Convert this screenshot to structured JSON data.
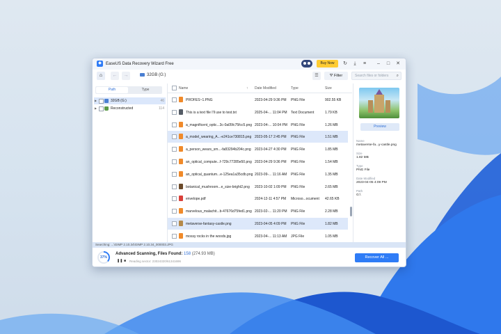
{
  "window": {
    "title": "EaseUS Data Recovery Wizard Free",
    "buy_now": "Buy Now",
    "logo_icon": "easeus-logo-icon"
  },
  "toolbar": {
    "drive_label": "32GB (G:)",
    "filter_label": "Filter",
    "search_placeholder": "Search files or folders"
  },
  "left_panel": {
    "tabs": [
      "Path",
      "Type"
    ],
    "tree": [
      {
        "label": "32GB (G:)",
        "count": "46",
        "selected": true
      },
      {
        "label": "Reconstructed",
        "count": "114",
        "selected": false
      }
    ]
  },
  "file_list": {
    "columns": [
      "Name",
      "Date Modified",
      "Type",
      "Size"
    ],
    "rows": [
      {
        "name": "PROFES~1.PNG",
        "date": "2023-04-29 9:36 PM",
        "type": "PNG File",
        "size": "902.55 KB",
        "icon_color": "#f08a2a",
        "selected": false
      },
      {
        "name": "This is a text file I'll use to test.txt",
        "date": "2025-04-... 11:04 PM",
        "type": "Text Document",
        "size": "1.79 KB",
        "icon_color": "#555c66",
        "selected": false
      },
      {
        "name": "a_magnificent_optic...3c-0a05fc75fcc5.png",
        "date": "2023-04-... 10:04 PM",
        "type": "PNG File",
        "size": "1.26 MB",
        "icon_color": "#f08a2a",
        "selected": false
      },
      {
        "name": "a_model_wearing_A...-e241ce730815.png",
        "date": "2023-05-17 2:45 PM",
        "type": "PNG File",
        "size": "1.51 MB",
        "icon_color": "#f08a2a",
        "selected": true
      },
      {
        "name": "a_person_wears_sm...-fa83294b204c.png",
        "date": "2023-04-27 4:30 PM",
        "type": "PNG File",
        "size": "1.85 MB",
        "icon_color": "#f08a2a",
        "selected": false
      },
      {
        "name": "an_optical_compute...f-729c77285e50.png",
        "date": "2023-04-29 9:36 PM",
        "type": "PNG File",
        "size": "1.54 MB",
        "icon_color": "#f08a2a",
        "selected": false
      },
      {
        "name": "an_optical_quantum...e-125ea1a35cdb.png",
        "date": "2023-09-... 11:16 AM",
        "type": "PNG File",
        "size": "1.35 MB",
        "icon_color": "#f08a2a",
        "selected": false
      },
      {
        "name": "botanical_mushroom...e_size-bright2.png",
        "date": "2023-10-02 1:09 PM",
        "type": "PNG File",
        "size": "2.65 MB",
        "icon_color": "#6b4a2a",
        "selected": false
      },
      {
        "name": "envelope.pdf",
        "date": "2024-12-11 4:57 PM",
        "type": "Microso...ocument",
        "size": "42.65 KB",
        "icon_color": "#d9403a",
        "selected": false
      },
      {
        "name": "marvelous_malachit...b-47676d75fed1.png",
        "date": "2023-02-... 11:20 PM",
        "type": "PNG File",
        "size": "2.28 MB",
        "icon_color": "#f08a2a",
        "selected": false
      },
      {
        "name": "metaverse-fantasy-castle.png",
        "date": "2023-04-05 4:09 PM",
        "type": "PNG File",
        "size": "1.82 MB",
        "icon_color": "#b58a4a",
        "selected": true
      },
      {
        "name": "mossy rocks in the woods.jpg",
        "date": "2023-04-... 11:13 AM",
        "type": "JPG File",
        "size": "1.05 MB",
        "icon_color": "#f08a2a",
        "selected": false
      }
    ]
  },
  "details": {
    "preview_label": "Preview",
    "name_label": "Name",
    "name_value": "metaverse-fa...y-castle.png",
    "size_label": "Size",
    "size_value": "1.82 MB",
    "type_label": "Type",
    "type_value": "PNG File",
    "date_label": "Date Modified",
    "date_value": "2023-04-05 4:09 PM",
    "path_label": "Path",
    "path_value": "G:\\"
  },
  "status": {
    "searching": "Searching: ...\\GIMP 2.10.34\\GIMP 2.10.34_000003.JPG",
    "progress_percent": 37,
    "progress_text": "37%",
    "scan_title": "Advanced Scanning, Files Found:",
    "files_found": "158",
    "total_size": "(274.93 MB)",
    "sector_text": "Reading sector: 23024320/61341696",
    "recover_label": "Recover All ..."
  }
}
